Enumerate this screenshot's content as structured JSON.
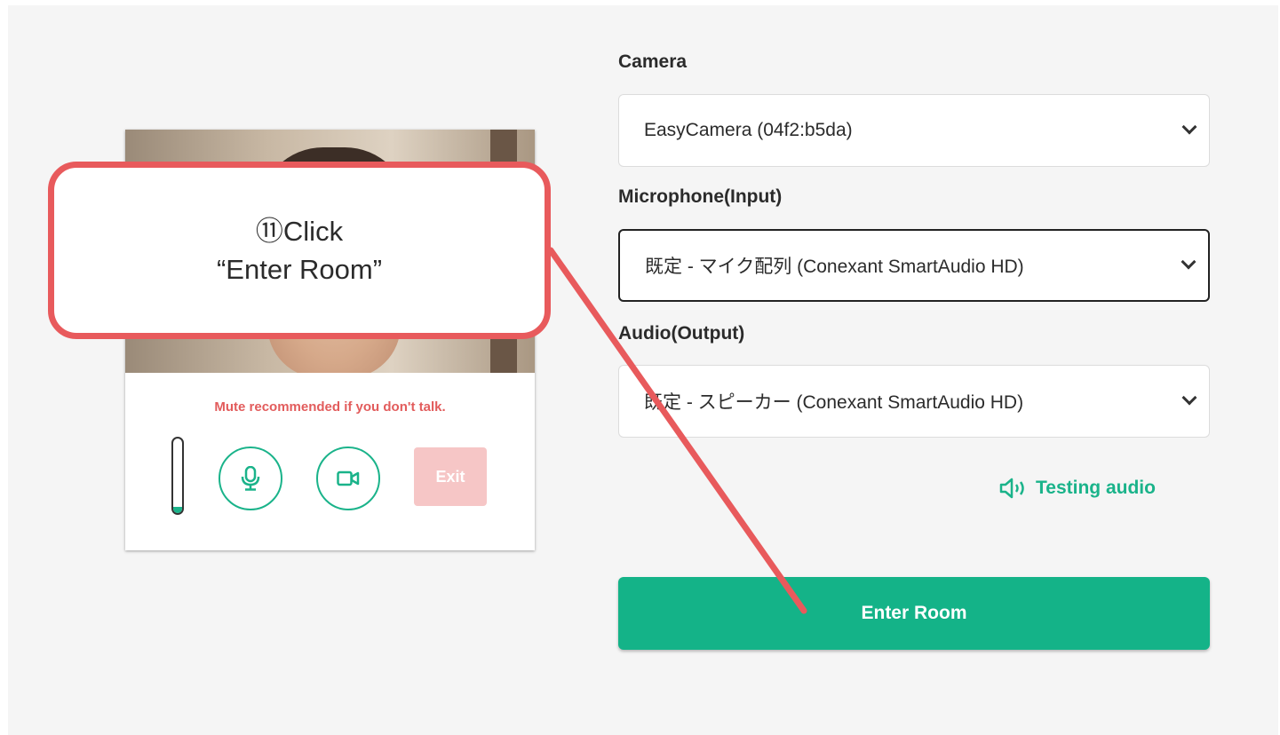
{
  "preview": {
    "mute_note": "Mute recommended if you don't talk.",
    "mic_level": 0.08,
    "mic_button_icon": "microphone-icon",
    "camera_button_icon": "video-camera-icon",
    "exit_label": "Exit"
  },
  "devices": {
    "camera": {
      "label": "Camera",
      "value": "EasyCamera (04f2:b5da)"
    },
    "microphone": {
      "label": "Microphone(Input)",
      "value": "既定 - マイク配列 (Conexant SmartAudio HD)"
    },
    "audio": {
      "label": "Audio(Output)",
      "value": "既定 - スピーカー (Conexant SmartAudio HD)"
    }
  },
  "testing_audio": {
    "label": "Testing audio",
    "icon": "speaker-icon"
  },
  "enter_button": {
    "label": "Enter Room"
  },
  "annotation": {
    "line1": "⑪Click",
    "line2": "“Enter Room”",
    "color": "#e85a5c"
  },
  "colors": {
    "accent": "#14b388",
    "warning": "#e25c5c",
    "exit_disabled": "#f6c6c6"
  }
}
